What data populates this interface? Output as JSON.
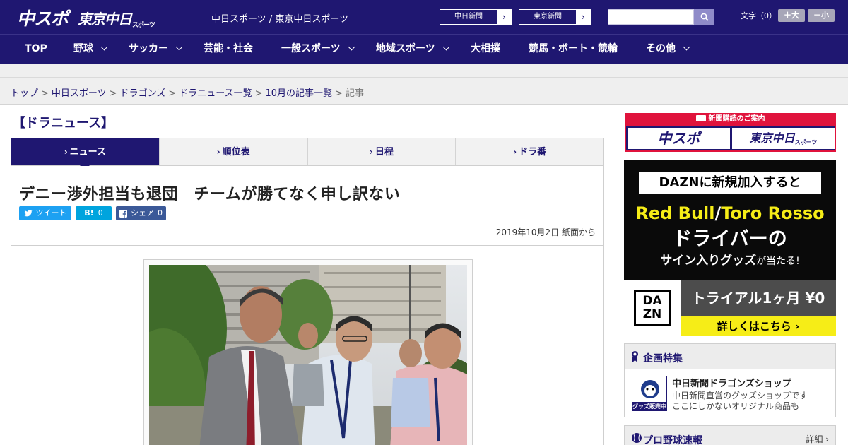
{
  "header": {
    "logo_chuspo": "中スポ",
    "logo_tokyo": "東京中日",
    "logo_tokyo_sub": "スポーツ",
    "site_title": "中日スポーツ / 東京中日スポーツ",
    "paper_links": [
      "中日新聞",
      "東京新聞"
    ],
    "search": {
      "placeholder": ""
    },
    "font_size_label": "文字（0）",
    "font_buttons": {
      "increase": "＋大",
      "decrease": "－小"
    }
  },
  "nav": {
    "items": [
      {
        "label": "TOP",
        "has_dropdown": false
      },
      {
        "label": "野球",
        "has_dropdown": true
      },
      {
        "label": "サッカー",
        "has_dropdown": true
      },
      {
        "label": "芸能・社会",
        "has_dropdown": false
      },
      {
        "label": "一般スポーツ",
        "has_dropdown": true
      },
      {
        "label": "地域スポーツ",
        "has_dropdown": true
      },
      {
        "label": "大相撲",
        "has_dropdown": false
      },
      {
        "label": "競馬・ボート・競輪",
        "has_dropdown": false
      },
      {
        "label": "その他",
        "has_dropdown": true
      }
    ]
  },
  "breadcrumb": {
    "links": [
      "トップ",
      "中日スポーツ",
      "ドラゴンズ",
      "ドラニュース一覧",
      "10月の記事一覧"
    ],
    "current": "記事",
    "separator": ">"
  },
  "section": {
    "title": "【ドラニュース】"
  },
  "tabs": [
    {
      "label": "ニュース",
      "active": true
    },
    {
      "label": "順位表",
      "active": false
    },
    {
      "label": "日程",
      "active": false
    },
    {
      "label": "ドラ番",
      "active": false
    }
  ],
  "article": {
    "headline": "デニー渉外担当も退団　チームが勝てなく申し訳ない",
    "share": {
      "tweet": "ツイート",
      "hatena_label": "B!",
      "hatena_count": "0",
      "facebook": "シェア",
      "facebook_count": "0"
    },
    "date": "2019年10月2日",
    "source": "紙面から"
  },
  "sidebar": {
    "subscribe": {
      "heading": "新聞購読のご案内",
      "buttons": [
        "中スポ",
        "東京中日"
      ],
      "button_sub": "スポーツ"
    },
    "ad": {
      "top": "DAZNに新規加入すると",
      "brand1": "Red Bull",
      "slash": "/",
      "brand2": "Toro Rosso",
      "line2": "ドライバーの",
      "line3_main": "サイン入りグッズ",
      "line3_tail": "が当たる!",
      "logo_top": "DA",
      "logo_bottom": "ZN",
      "trial": "トライアル1ヶ月 ¥0",
      "cta": "詳しくはこちら"
    },
    "feature": {
      "title": "企画特集",
      "shop_title": "中日新聞ドラゴンズショップ",
      "shop_desc_1": "中日新聞直営のグッズショップです",
      "shop_desc_2": "ここにしかないオリジナル商品も",
      "thumb_label": "グッズ販売中"
    },
    "baseball": {
      "title": "プロ野球速報",
      "detail": "詳細"
    }
  },
  "colors": {
    "brand_navy": "#1f1771",
    "accent_red": "#e0133c",
    "dazn_yellow": "#f6ed17",
    "twitter": "#1da1f2",
    "hatena": "#00a4de",
    "facebook": "#3b5998"
  }
}
